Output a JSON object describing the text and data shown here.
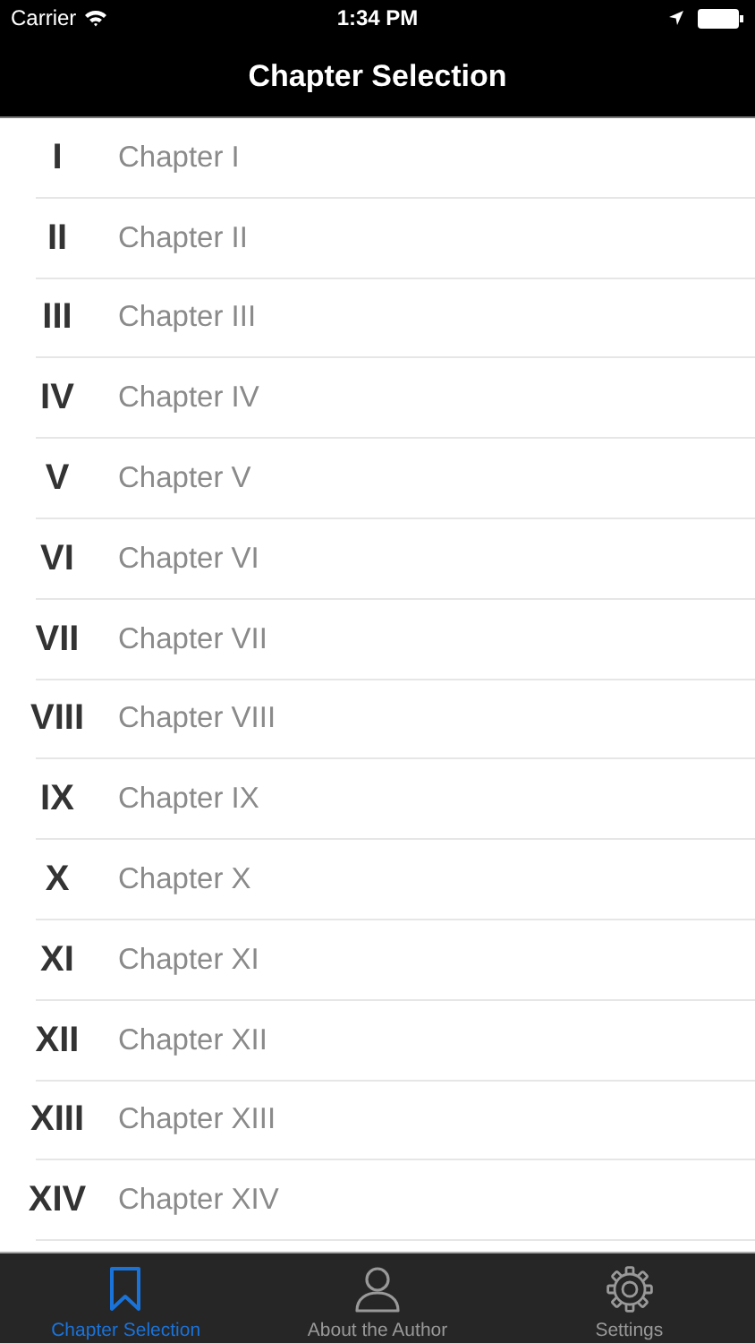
{
  "status_bar": {
    "carrier": "Carrier",
    "time": "1:34 PM"
  },
  "nav_bar": {
    "title": "Chapter Selection"
  },
  "chapters": [
    {
      "numeral": "I",
      "title": "Chapter I"
    },
    {
      "numeral": "II",
      "title": "Chapter II"
    },
    {
      "numeral": "III",
      "title": "Chapter III"
    },
    {
      "numeral": "IV",
      "title": "Chapter IV"
    },
    {
      "numeral": "V",
      "title": "Chapter V"
    },
    {
      "numeral": "VI",
      "title": "Chapter VI"
    },
    {
      "numeral": "VII",
      "title": "Chapter VII"
    },
    {
      "numeral": "VIII",
      "title": "Chapter VIII"
    },
    {
      "numeral": "IX",
      "title": "Chapter IX"
    },
    {
      "numeral": "X",
      "title": "Chapter X"
    },
    {
      "numeral": "XI",
      "title": "Chapter XI"
    },
    {
      "numeral": "XII",
      "title": "Chapter XII"
    },
    {
      "numeral": "XIII",
      "title": "Chapter XIII"
    },
    {
      "numeral": "XIV",
      "title": "Chapter XIV"
    }
  ],
  "tab_bar": [
    {
      "kind": "bookmark",
      "label": "Chapter Selection",
      "selected": true
    },
    {
      "kind": "person",
      "label": "About the Author",
      "selected": false
    },
    {
      "kind": "gear",
      "label": "Settings",
      "selected": false
    }
  ]
}
